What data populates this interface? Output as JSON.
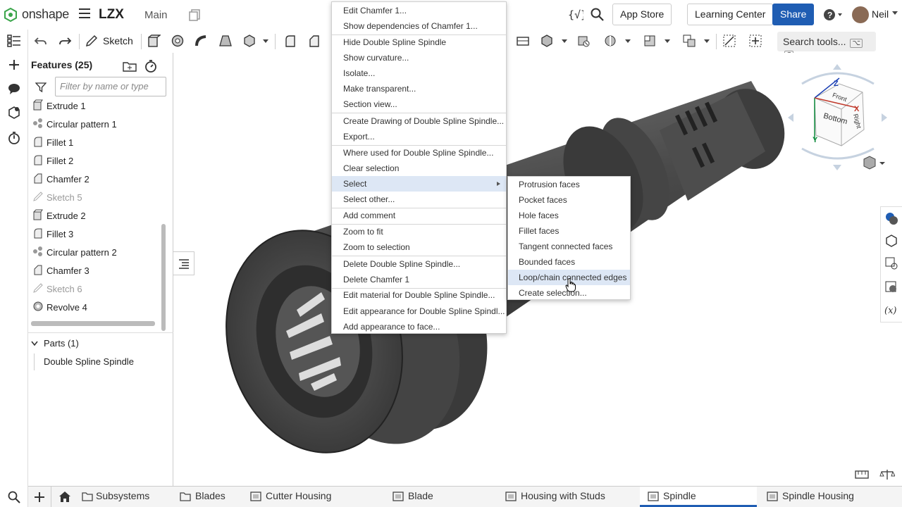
{
  "app": {
    "logo_text": "onshape",
    "document_name": "LZX",
    "workspace": "Main",
    "app_store": "App Store",
    "learning_center": "Learning Center",
    "share": "Share",
    "user": "Neil",
    "help_icon": "help-icon"
  },
  "toolbar": {
    "sketch_label": "Sketch",
    "search_tools": "Search tools...",
    "search_shortcut_1": "⌥",
    "search_shortcut_2": "C"
  },
  "panel": {
    "title": "Features (25)",
    "filter_placeholder": "Filter by name or type",
    "features": [
      {
        "label": "Extrude 1",
        "icon": "extrude-icon",
        "dim": false
      },
      {
        "label": "Circular pattern 1",
        "icon": "circular-pattern-icon",
        "dim": false
      },
      {
        "label": "Fillet 1",
        "icon": "fillet-icon",
        "dim": false
      },
      {
        "label": "Fillet 2",
        "icon": "fillet-icon",
        "dim": false
      },
      {
        "label": "Chamfer 2",
        "icon": "chamfer-icon",
        "dim": false
      },
      {
        "label": "Sketch 5",
        "icon": "sketch-icon",
        "dim": true
      },
      {
        "label": "Extrude 2",
        "icon": "extrude-icon",
        "dim": false
      },
      {
        "label": "Fillet 3",
        "icon": "fillet-icon",
        "dim": false
      },
      {
        "label": "Circular pattern 2",
        "icon": "circular-pattern-icon",
        "dim": false
      },
      {
        "label": "Chamfer 3",
        "icon": "chamfer-icon",
        "dim": false
      },
      {
        "label": "Sketch 6",
        "icon": "sketch-icon",
        "dim": true
      },
      {
        "label": "Revolve 4",
        "icon": "revolve-icon",
        "dim": false
      }
    ],
    "parts_header": "Parts (1)",
    "part_name": "Double Spline Spindle"
  },
  "context_menu": {
    "items": [
      "Edit Chamfer 1...",
      "Show dependencies of Chamfer 1...",
      "Hide Double Spline Spindle",
      "Show curvature...",
      "Isolate...",
      "Make transparent...",
      "Section view...",
      "Create Drawing of Double Spline Spindle...",
      "Export...",
      "Where used for Double Spline Spindle...",
      "Clear selection",
      "Select",
      "Select other...",
      "Add comment",
      "Zoom to fit",
      "Zoom to selection",
      "Delete Double Spline Spindle...",
      "Delete Chamfer 1",
      "Edit material for Double Spline Spindle...",
      "Edit appearance for Double Spline Spindl...",
      "Add appearance to face..."
    ],
    "highlighted": "Select"
  },
  "submenu": {
    "items": [
      "Protrusion faces",
      "Pocket faces",
      "Hole faces",
      "Fillet faces",
      "Tangent connected faces",
      "Bounded faces",
      "Loop/chain connected edges",
      "Create selection..."
    ],
    "highlighted": "Loop/chain connected edges"
  },
  "view_cube": {
    "front": "Front",
    "bottom": "Bottom",
    "right": "Right",
    "axis_x": "X",
    "axis_y": "Y",
    "axis_z": "Z"
  },
  "tabs": [
    {
      "label": "Subsystems",
      "icon": "folder-icon",
      "active": false
    },
    {
      "label": "Blades",
      "icon": "folder-icon",
      "active": false
    },
    {
      "label": "Cutter Housing",
      "icon": "part-studio-icon",
      "active": false
    },
    {
      "label": "Blade",
      "icon": "part-studio-icon",
      "active": false
    },
    {
      "label": "Housing with Studs",
      "icon": "part-studio-icon",
      "active": false
    },
    {
      "label": "Spindle",
      "icon": "part-studio-icon",
      "active": true
    },
    {
      "label": "Spindle Housing",
      "icon": "part-studio-icon",
      "active": false
    }
  ],
  "colors": {
    "accent": "#1f5db3",
    "menu_highlight": "#dde7f5",
    "model_gray": "#4a4a4a"
  }
}
